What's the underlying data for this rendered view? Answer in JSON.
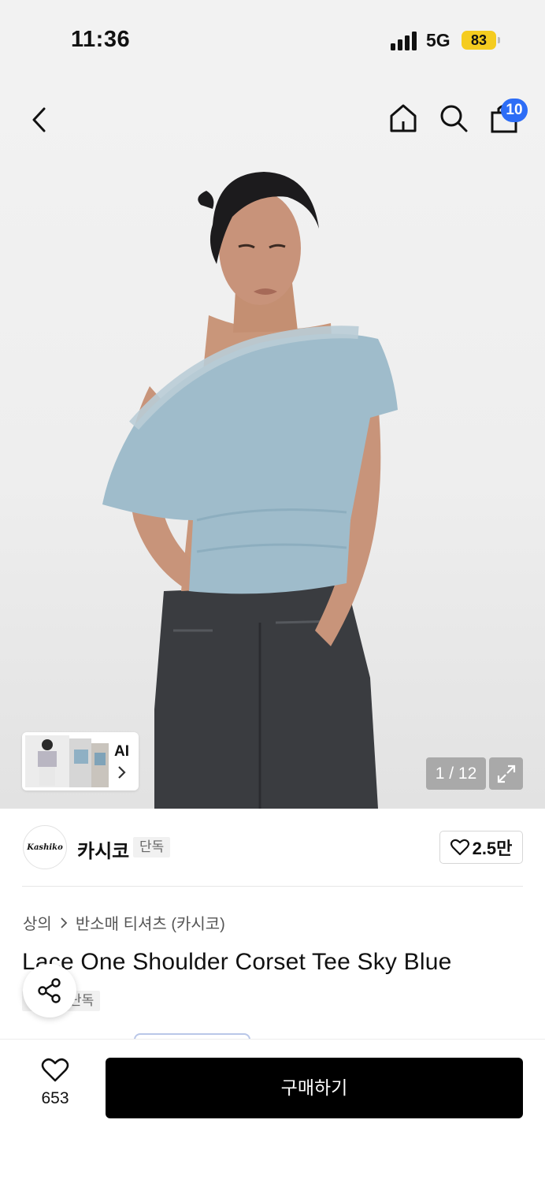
{
  "status_bar": {
    "time": "11:36",
    "network": "5G",
    "battery": "83"
  },
  "header": {
    "back_icon": "chevron-left-icon",
    "home_icon": "home-icon",
    "search_icon": "search-icon",
    "cart_icon": "bag-icon",
    "cart_count": "10"
  },
  "gallery": {
    "ai_label": "AI",
    "counter": "1 / 12",
    "expand_icon": "expand-icon"
  },
  "brand": {
    "logo_text": "Kashiko",
    "name": "카시코",
    "tag": "단독",
    "likes": "2.5만"
  },
  "breadcrumb": {
    "category": "상의",
    "subcategory": "반소매 티셔츠 (카시코)"
  },
  "product": {
    "title": "Lace One Shoulder Corset Tee Sky Blue",
    "tag": "단독"
  },
  "bottom": {
    "wish_count": "653",
    "buy_label": "구매하기"
  },
  "colors": {
    "accent_badge": "#2d6df6",
    "battery": "#f5cc1f",
    "buy_button": "#000000"
  }
}
